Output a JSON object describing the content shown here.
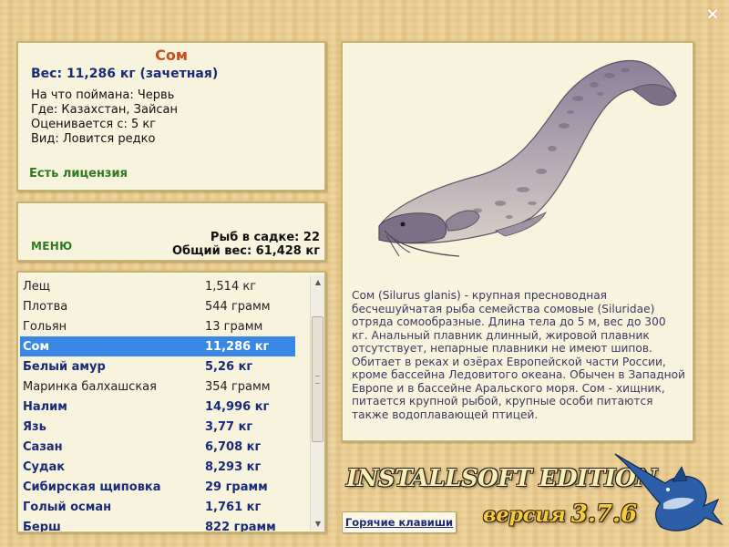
{
  "window": {
    "close_label": "×"
  },
  "fish": {
    "name": "Сом",
    "weight_line": "Вес: 11,286 кг (зачетная)",
    "bait": "На что поймана: Червь",
    "location": "Где: Казахстан, Зайсан",
    "value": "Оценивается с: 5 кг",
    "rarity": "Вид: Ловится редко",
    "license": "Есть лицензия",
    "description": "Сом (Silurus glanis) - крупная пресноводная бесчешуйчатая рыба семейства сомовые (Siluridae) отряда сомообразные. Длина тела до 5 м, вес до 300 кг. Анальный плавник длинный, жировой плавник отсутствует, непарные плавники не имеют шипов. Обитает в реках и озёрах Европейской части России, кроме бассейна Ледовитого океана. Обычен в Западной Европе и в бассейне Аральского моря. Сом - хищник, питается крупной рыбой, крупные особи питаются также водоплавающей птицей."
  },
  "menu": {
    "label": "МЕНЮ",
    "catch_count": "Рыб в садке: 22",
    "total_weight": "Общий вес: 61,428 кг"
  },
  "catch_list": [
    {
      "name": "Лещ",
      "weight": "1,514 кг",
      "style": "normal"
    },
    {
      "name": "Плотва",
      "weight": "544 грамм",
      "style": "normal"
    },
    {
      "name": "Гольян",
      "weight": "13 грамм",
      "style": "normal"
    },
    {
      "name": "Сом",
      "weight": "11,286 кг",
      "style": "selected"
    },
    {
      "name": "Белый амур",
      "weight": "5,26 кг",
      "style": "bold"
    },
    {
      "name": "Маринка балхашская",
      "weight": "354 грамм",
      "style": "normal"
    },
    {
      "name": "Налим",
      "weight": "14,996 кг",
      "style": "bold"
    },
    {
      "name": "Язь",
      "weight": "3,77 кг",
      "style": "bold"
    },
    {
      "name": "Сазан",
      "weight": "6,708 кг",
      "style": "bold"
    },
    {
      "name": "Судак",
      "weight": "8,293 кг",
      "style": "bold"
    },
    {
      "name": "Сибирская щиповка",
      "weight": "29 грамм",
      "style": "bold"
    },
    {
      "name": "Голый осман",
      "weight": "1,761 кг",
      "style": "bold"
    },
    {
      "name": "Берш",
      "weight": "822 грамм",
      "style": "bold"
    }
  ],
  "brand": {
    "title": "INSTALLSOFT EDITION",
    "version_word": "версия",
    "version_number": "3.7.6"
  },
  "buttons": {
    "hotkeys": "Горячие клавиши"
  },
  "colors": {
    "selection": "#3a87e6",
    "title": "#c8501a",
    "accent_blue": "#1a2a78",
    "license_green": "#2e7a1e"
  }
}
